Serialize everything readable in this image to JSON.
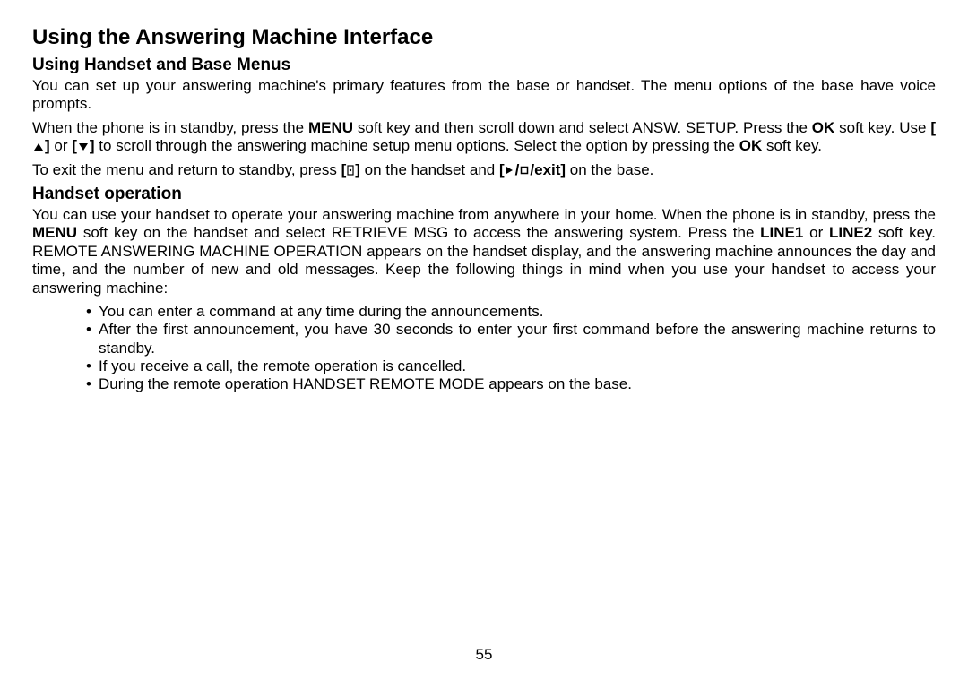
{
  "title": "Using the Answering Machine Interface",
  "section1": {
    "heading": "Using Handset and Base Menus",
    "p1": "You can set up your answering machine's primary features from the base or handset. The menu options of the base have voice prompts.",
    "p2a": "When the phone is in standby, press the ",
    "p2_menu": "MENU",
    "p2b": " soft key and then scroll down and select ANSW. SETUP. Press the ",
    "p2_ok1": "OK",
    "p2c": " soft key. Use ",
    "p2d": " or ",
    "p2e": " to scroll through the answering machine setup menu options. Select the option by pressing the ",
    "p2_ok2": "OK",
    "p2f": " soft key.",
    "p3a": "To exit the menu and return to standby, press ",
    "p3b": " on the handset and ",
    "p3c_pre": "[",
    "p3c_mid": "/",
    "p3c_exit": "/exit]",
    "p3d": " on the base."
  },
  "section2": {
    "heading": "Handset operation",
    "p1a": "You can use your handset to operate your answering machine from anywhere in your home. When the phone is in standby, press the ",
    "p1_menu": "MENU",
    "p1b": " soft key on the handset and select RETRIEVE MSG to access the answering system. Press the ",
    "p1_line1": "LINE1",
    "p1c": " or ",
    "p1_line2": "LINE2",
    "p1d": " soft key. REMOTE ANSWERING MACHINE OPERATION appears on the handset display, and the answering machine announces the day and time, and the number of new and old messages. Keep the following things in mind when you use your handset to access your answering machine:",
    "bullets": [
      "You can enter a command at any time during the announcements.",
      "After the first announcement, you have 30 seconds to enter your first command before the answering machine returns to standby.",
      "If you receive a call, the remote operation is cancelled.",
      "During the remote operation HANDSET REMOTE MODE appears on the base."
    ]
  },
  "page_number": "55"
}
